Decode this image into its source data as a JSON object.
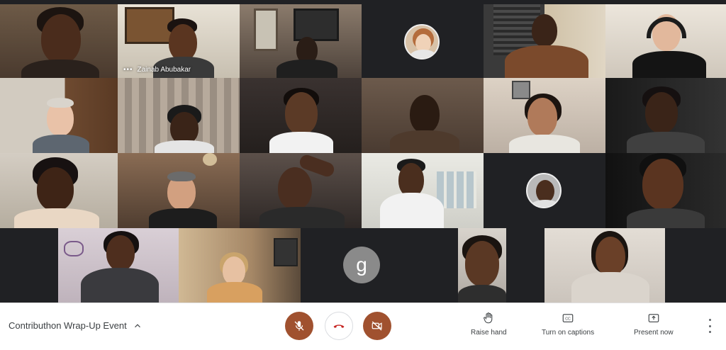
{
  "participants": [
    {
      "id": "p1",
      "name": ""
    },
    {
      "id": "p2",
      "name": "Zainab Abubakar"
    },
    {
      "id": "p3",
      "name": ""
    },
    {
      "id": "p4",
      "name": "",
      "avatar": true
    },
    {
      "id": "p5",
      "name": ""
    },
    {
      "id": "p6",
      "name": ""
    },
    {
      "id": "p7",
      "name": ""
    },
    {
      "id": "p8",
      "name": ""
    },
    {
      "id": "p9",
      "name": ""
    },
    {
      "id": "p10",
      "name": ""
    },
    {
      "id": "p11",
      "name": ""
    },
    {
      "id": "p12",
      "name": ""
    },
    {
      "id": "p13",
      "name": ""
    },
    {
      "id": "p14",
      "name": ""
    },
    {
      "id": "p15",
      "name": ""
    },
    {
      "id": "p16",
      "name": ""
    },
    {
      "id": "p17",
      "name": "",
      "avatar": true
    },
    {
      "id": "p18",
      "name": ""
    },
    {
      "id": "p19",
      "name": ""
    },
    {
      "id": "p20",
      "name": ""
    },
    {
      "id": "p21",
      "name": "g",
      "letter_avatar": true
    },
    {
      "id": "p22",
      "name": ""
    },
    {
      "id": "p23",
      "name": ""
    }
  ],
  "bar": {
    "meeting_title": "Contributhon Wrap-Up Event",
    "raise_hand": "Raise hand",
    "captions": "Turn on captions",
    "present": "Present now"
  },
  "colors": {
    "control_brown": "#a0512f",
    "stage_bg": "#202124"
  },
  "icons": [
    "chevron-up-icon",
    "mic-off-icon",
    "hang-up-icon",
    "camera-off-icon",
    "hand-icon",
    "captions-icon",
    "present-icon",
    "more-vert-icon"
  ]
}
